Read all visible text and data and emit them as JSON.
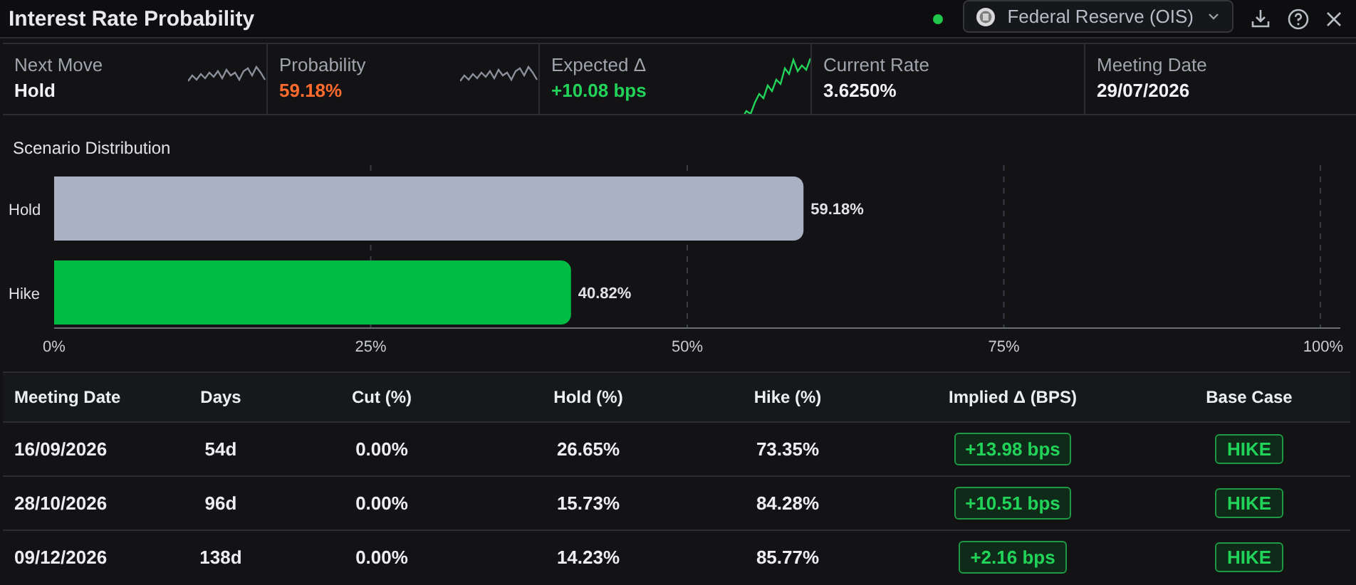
{
  "window": {
    "title": "Interest Rate Probability"
  },
  "status": {
    "live": true
  },
  "source_select": {
    "value": "Federal Reserve (OIS)"
  },
  "stats": [
    {
      "label": "Next Move",
      "value": "Hold",
      "kind": "move"
    },
    {
      "label": "Probability",
      "value": "59.18%",
      "kind": "probability"
    },
    {
      "label": "Expected Δ",
      "value": "+10.08 bps",
      "kind": "delta"
    },
    {
      "label": "Current Rate",
      "value": "3.6250%",
      "kind": "plain"
    },
    {
      "label": "Meeting Date",
      "value": "29/07/2026",
      "kind": "plain"
    }
  ],
  "scenario": {
    "title": "Scenario Distribution",
    "chart_data": {
      "type": "bar",
      "orientation": "horizontal",
      "stacked": true,
      "categories": [
        "Hold",
        "Hike"
      ],
      "series": [
        {
          "color": "#a9b1c3",
          "values": [
            59.18,
            null
          ]
        },
        {
          "color": "#00bc45",
          "values": [
            null,
            40.82
          ]
        }
      ],
      "xlim": [
        0,
        100
      ],
      "xticks": [
        {
          "value": 0,
          "label": "0%"
        },
        {
          "value": 25,
          "label": "25%"
        },
        {
          "value": 50,
          "label": "50%"
        },
        {
          "value": 75,
          "label": "75%"
        },
        {
          "value": 100,
          "label": "100%"
        }
      ],
      "grid": true,
      "value_labels": [
        "59.18%",
        "40.82%"
      ]
    }
  },
  "table": {
    "columns": [
      "Meeting Date",
      "Days",
      "Cut (%)",
      "Hold (%)",
      "Hike (%)",
      "Implied Δ (BPS)",
      "Base Case"
    ],
    "rows": [
      {
        "date": "16/09/2026",
        "days": "54d",
        "cut": "0.00%",
        "hold": "26.65%",
        "hike": "73.35%",
        "implied": "+13.98 bps",
        "base_case": "HIKE",
        "kind": "up"
      },
      {
        "date": "28/10/2026",
        "days": "96d",
        "cut": "0.00%",
        "hold": "15.73%",
        "hike": "84.28%",
        "implied": "+10.51 bps",
        "base_case": "HIKE",
        "kind": "up"
      },
      {
        "date": "09/12/2026",
        "days": "138d",
        "cut": "0.00%",
        "hold": "14.23%",
        "hike": "85.77%",
        "implied": "+2.16 bps",
        "base_case": "HIKE",
        "kind": "up"
      }
    ]
  }
}
